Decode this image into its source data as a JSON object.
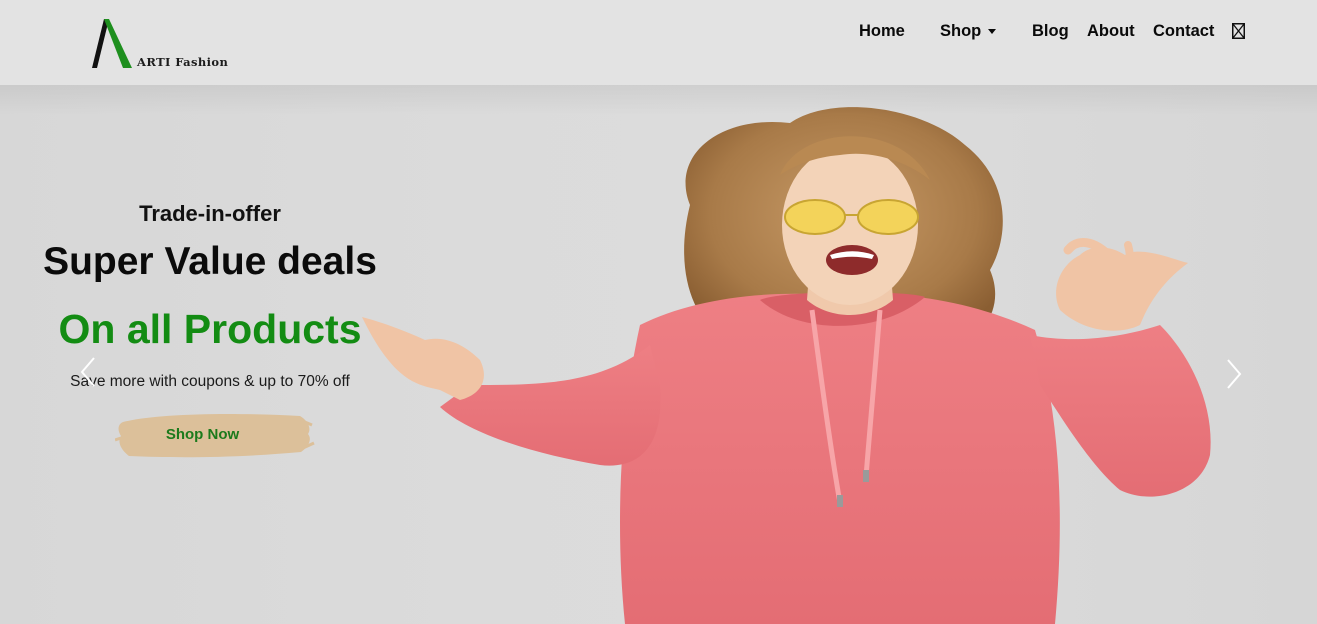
{
  "brand": {
    "name": "ARTI Fashion",
    "accent": "#138c13"
  },
  "nav": {
    "items": [
      {
        "label": "Home"
      },
      {
        "label": "Shop"
      },
      {
        "label": "Blog"
      },
      {
        "label": "About"
      },
      {
        "label": "Contact"
      }
    ],
    "cart_icon": "shopping-bag-icon"
  },
  "hero": {
    "eyebrow": "Trade-in-offer",
    "headline": "Super Value deals",
    "highlight": "On all Products",
    "subtext": "Save more with coupons & up to 70% off",
    "cta_label": "Shop Now",
    "prev_icon": "chevron-left-icon",
    "next_icon": "chevron-right-icon"
  }
}
